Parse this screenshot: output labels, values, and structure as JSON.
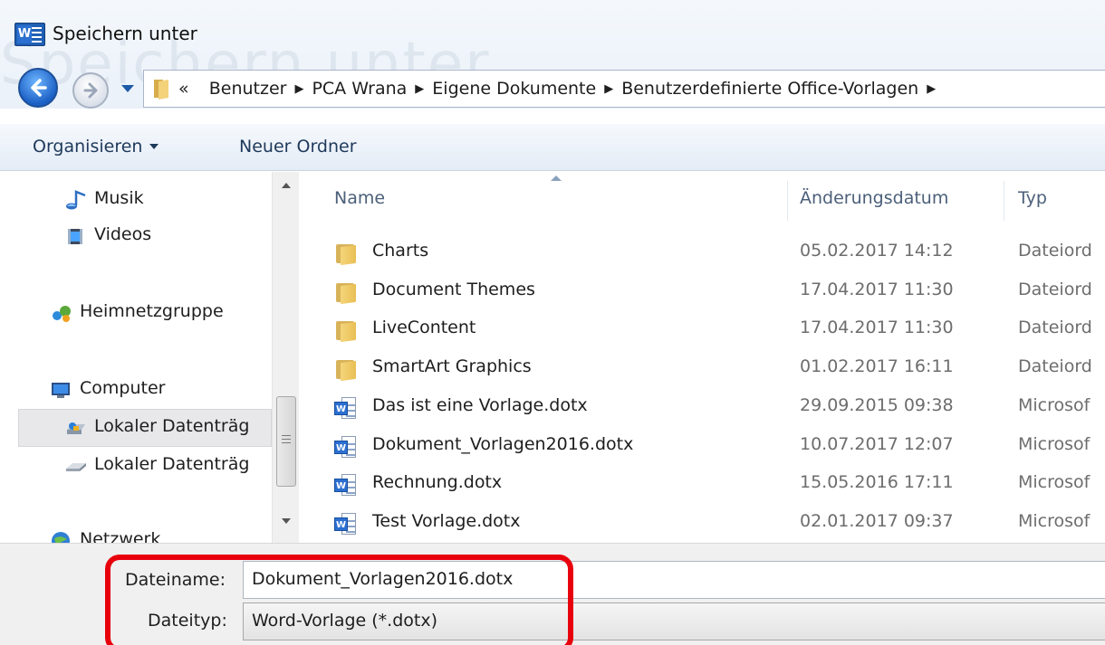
{
  "window": {
    "title": "Speichern unter",
    "ghost_title": "Speichern unter",
    "app_icon": "word-icon"
  },
  "address_bar": {
    "overflow": "«",
    "separator": "▶",
    "crumbs": [
      "Benutzer",
      "PCA Wrana",
      "Eigene Dokumente",
      "Benutzerdefinierte Office-Vorlagen"
    ]
  },
  "toolbar": {
    "organize_label": "Organisieren",
    "new_folder_label": "Neuer Ordner"
  },
  "nav_pane": {
    "items": [
      {
        "label": "Musik",
        "icon": "music-icon"
      },
      {
        "label": "Videos",
        "icon": "videos-icon"
      },
      {
        "label": "Heimnetzgruppe",
        "icon": "homegroup-icon"
      },
      {
        "label": "Computer",
        "icon": "computer-icon"
      },
      {
        "label": "Lokaler Datenträg",
        "icon": "local-drive-icon",
        "selected": true
      },
      {
        "label": "Lokaler Datenträg",
        "icon": "drive-icon"
      },
      {
        "label": "Netzwerk",
        "icon": "network-icon"
      }
    ]
  },
  "file_list": {
    "columns": {
      "name": "Name",
      "date": "Änderungsdatum",
      "type": "Typ"
    },
    "rows": [
      {
        "name": "Charts",
        "date": "05.02.2017 14:12",
        "type": "Dateiord",
        "icon": "folder-icon"
      },
      {
        "name": "Document Themes",
        "date": "17.04.2017 11:30",
        "type": "Dateiord",
        "icon": "folder-icon"
      },
      {
        "name": "LiveContent",
        "date": "17.04.2017 11:30",
        "type": "Dateiord",
        "icon": "folder-icon"
      },
      {
        "name": "SmartArt Graphics",
        "date": "01.02.2017 16:11",
        "type": "Dateiord",
        "icon": "folder-icon"
      },
      {
        "name": "Das ist eine Vorlage.dotx",
        "date": "29.09.2015 09:38",
        "type": "Microsof",
        "icon": "word-document-icon"
      },
      {
        "name": "Dokument_Vorlagen2016.dotx",
        "date": "10.07.2017 12:07",
        "type": "Microsof",
        "icon": "word-document-icon"
      },
      {
        "name": "Rechnung.dotx",
        "date": "15.05.2016 17:11",
        "type": "Microsof",
        "icon": "word-document-icon"
      },
      {
        "name": "Test Vorlage.dotx",
        "date": "02.01.2017 09:37",
        "type": "Microsof",
        "icon": "word-document-icon"
      }
    ]
  },
  "form": {
    "filename_label": "Dateiname:",
    "filename_value": "Dokument_Vorlagen2016.dotx",
    "filetype_label": "Dateityp:",
    "filetype_value": "Word-Vorlage (*.dotx)"
  },
  "colors": {
    "highlight": "#e8000d",
    "toolbar_text": "#1e395b",
    "folder": "#f5d57b",
    "word_blue": "#2b6fd0"
  }
}
